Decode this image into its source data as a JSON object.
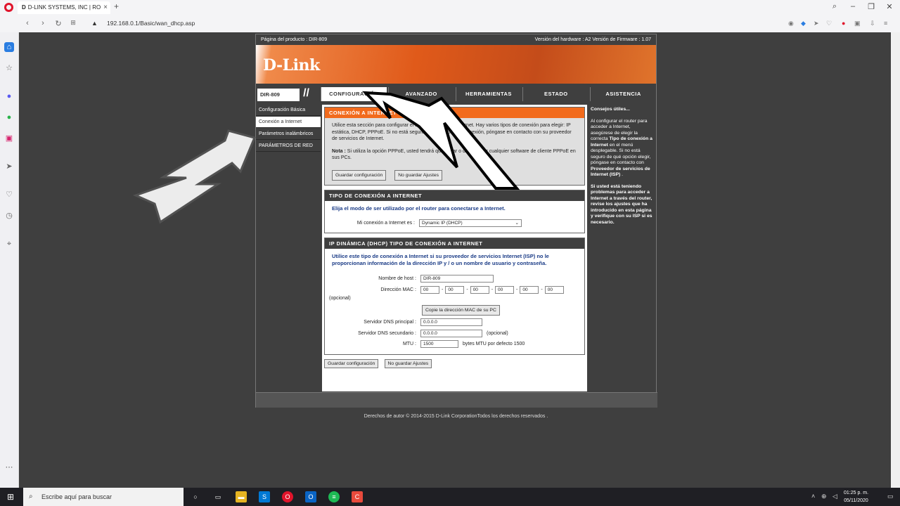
{
  "browser": {
    "tab_title": "D-LINK SYSTEMS, INC | RO",
    "tab_favicon": "D",
    "url": "192.168.0.1/Basic/wan_dhcp.asp"
  },
  "router": {
    "product_page": "Página del producto : DIR-809",
    "hw_fw": "Versión del hardware : A2   Versión de Firmware : 1.07",
    "logo": "D-Link",
    "model": "DIR-809",
    "tabs": [
      "CONFIGURACIÓN",
      "AVANZADO",
      "HERRAMIENTAS",
      "ESTADO",
      "ASISTENCIA"
    ],
    "leftnav": [
      "Configuración Básica",
      "Conexión a Internet",
      "Parámetros inalámbricos",
      "PARÁMETROS DE RED"
    ],
    "conn_box": {
      "title": "CONEXIÓN A INTERNET",
      "text": "Utilice esta sección para configurar el tipo de conexión a Internet. Hay varios tipos de conexión para elegir: IP estática, DHCP, PPPoE. Si no está seguro de su método de conexión, póngase en contacto con su proveedor de servicios de Internet.",
      "note_label": "Nota :",
      "note_text": "Si utiliza la opción PPPoE, usted tendrá que quitar o deshabilitar cualquier software de cliente PPPoE en sus PCs.",
      "save": "Guardar configuración",
      "nosave": "No guardar Ajustes"
    },
    "type_box": {
      "title": "TIPO DE CONEXIÓN A INTERNET",
      "intro": "Elija el modo de ser utilizado por el router para conectarse a Internet.",
      "label": "Mi conexión a Internet es :",
      "value": "Dynamic IP (DHCP)"
    },
    "dhcp_box": {
      "title": "IP DINÁMICA (DHCP) TIPO DE CONEXIÓN A INTERNET",
      "intro": "Utilice este tipo de conexión a Internet si su proveedor de servicios Internet (ISP) no le proporcionan información de la dirección IP y / o un nombre de usuario y contraseña.",
      "host_label": "Nombre de host :",
      "host_value": "DIR-809",
      "mac_label": "Dirección MAC :",
      "mac": [
        "00",
        "00",
        "00",
        "00",
        "00",
        "00"
      ],
      "optional": "(opcional)",
      "clone_btn": "Copie la dirección MAC de su PC",
      "dns1_label": "Servidor DNS principal :",
      "dns1": "0.0.0.0",
      "dns2_label": "Servidor DNS secundario :",
      "dns2": "0.0.0.0",
      "dns2_opt": "(opcional)",
      "mtu_label": "MTU :",
      "mtu": "1500",
      "mtu_note": "bytes MTU por defecto 1500"
    },
    "bottom_save": "Guardar configuración",
    "bottom_nosave": "No guardar Ajustes",
    "tips_title": "Consejos útiles...",
    "tips_p1_a": "Al configurar el router para acceder a Internet, asegúrese de elegir la correcta ",
    "tips_p1_b": "Tipo de conexión a Internet",
    "tips_p1_c": " en el menú desplegable. Si no está seguro de qué opción elegir, póngase en contacto con ",
    "tips_p1_d": "Proveedor de servicios de Internet (ISP)",
    "tips_p1_e": " .",
    "tips_p2": "Si usted está teniendo problemas para acceder a Internet a través del router, revise los ajustes que ha introducido en esta página y verifique con su ISP si es necesario.",
    "copyright": "Derechos de autor © 2014-2015 D-Link CorporationTodos los derechos reservados ."
  },
  "taskbar": {
    "search_placeholder": "Escribe aquí para buscar",
    "time": "01:25 p. m.",
    "date": "05/11/2020"
  },
  "colors": {
    "accent_orange": "#f26b1d",
    "dark_panel": "#3f3f3f",
    "link_blue": "#1a3b86"
  }
}
